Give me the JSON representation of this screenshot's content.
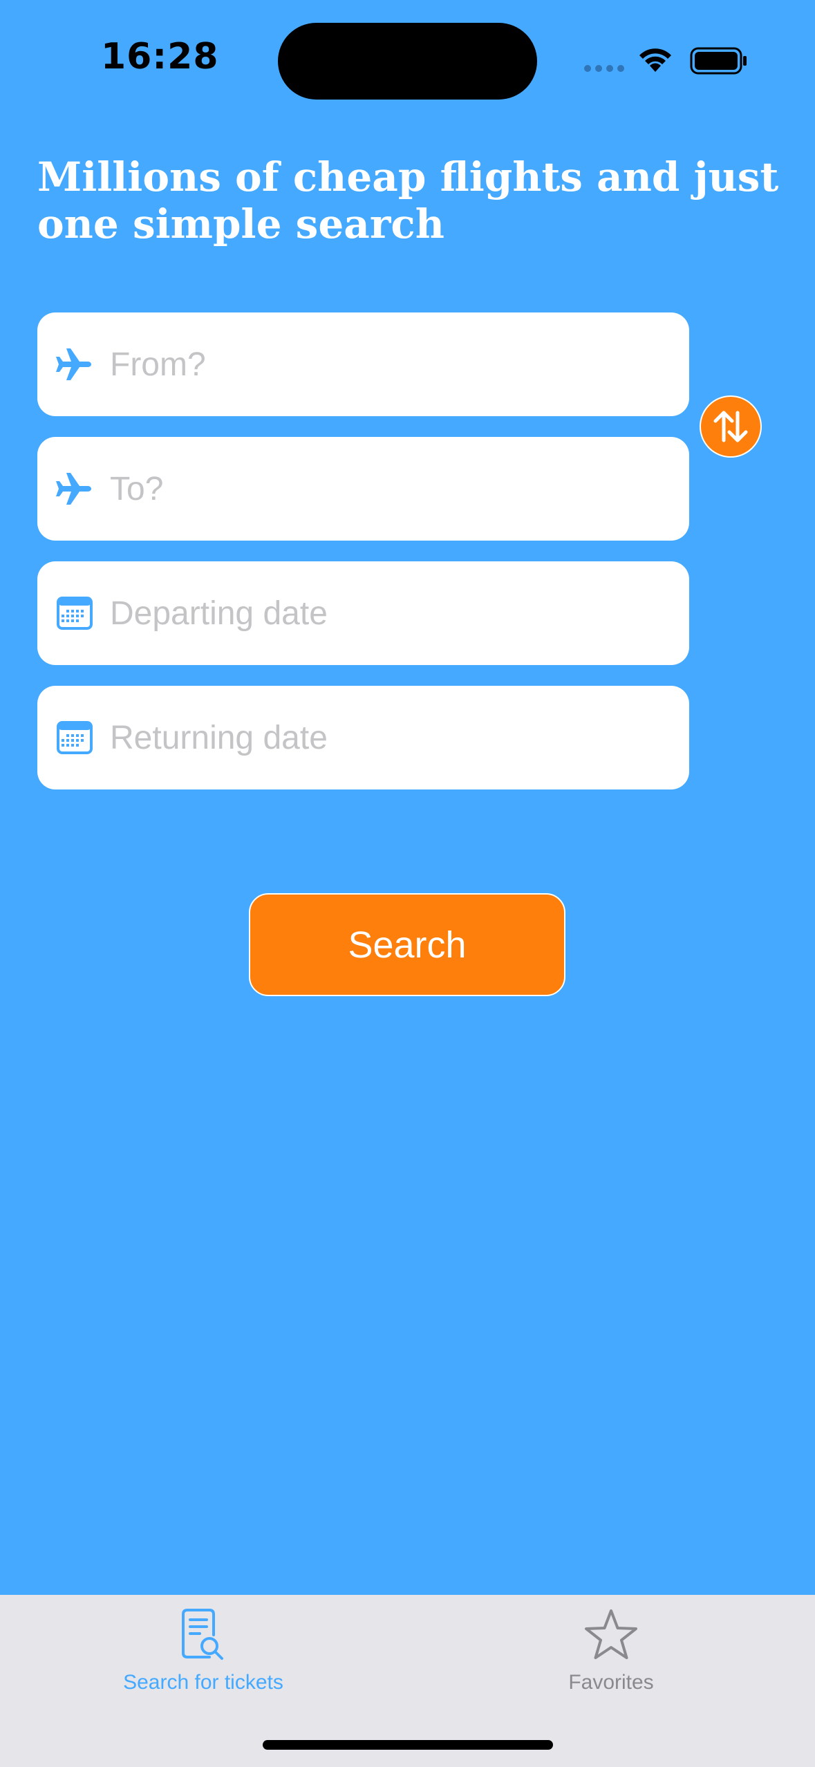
{
  "status_bar": {
    "time": "16:28"
  },
  "header": {
    "title": "Millions of cheap flights and just one simple search"
  },
  "form": {
    "from": {
      "placeholder": "From?",
      "value": "",
      "icon": "airplane-icon"
    },
    "to": {
      "placeholder": "To?",
      "value": "",
      "icon": "airplane-icon"
    },
    "departing": {
      "placeholder": "Departing date",
      "value": "",
      "icon": "calendar-icon"
    },
    "returning": {
      "placeholder": "Returning date",
      "value": "",
      "icon": "calendar-icon"
    },
    "swap_icon": "swap-arrows-icon",
    "search_label": "Search"
  },
  "tab_bar": {
    "tabs": [
      {
        "label": "Search for tickets",
        "icon": "search-document-icon",
        "selected": true
      },
      {
        "label": "Favorites",
        "icon": "star-icon",
        "selected": false
      }
    ]
  },
  "colors": {
    "background": "#45aaff",
    "accent": "#fe7f0b",
    "field": "#ffffff",
    "placeholder": "#c4c4c6",
    "tab_bar": "#e5e5ea",
    "tab_selected": "#45aaff",
    "tab_unselected": "#8a8a8e"
  }
}
